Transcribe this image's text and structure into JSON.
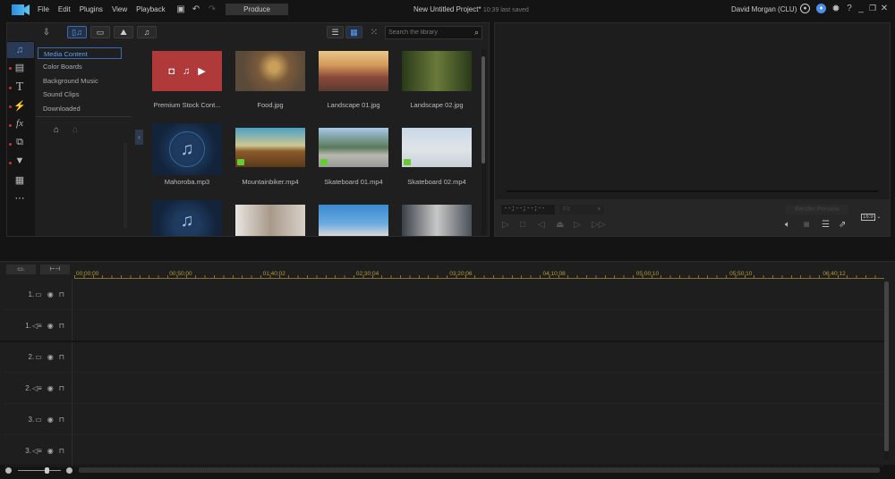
{
  "menu": [
    "File",
    "Edit",
    "Plugins",
    "View",
    "Playback"
  ],
  "produce_label": "Produce",
  "project_title": "New Untitled Project*",
  "save_status": "10:39 last saved",
  "user_name": "David Morgan (CLU)",
  "search_placeholder": "Search the library",
  "categories": [
    "Media Content",
    "Color Boards",
    "Background Music",
    "Sound Clips",
    "Downloaded"
  ],
  "media": [
    {
      "name": "Premium Stock Cont...",
      "type": "stock"
    },
    {
      "name": "Food.jpg",
      "type": "image"
    },
    {
      "name": "Landscape 01.jpg",
      "type": "image"
    },
    {
      "name": "Landscape 02.jpg",
      "type": "image"
    },
    {
      "name": "Mahoroba.mp3",
      "type": "audio"
    },
    {
      "name": "Mountainbiker.mp4",
      "type": "video"
    },
    {
      "name": "Skateboard 01.mp4",
      "type": "video"
    },
    {
      "name": "Skateboard 02.mp4",
      "type": "video"
    }
  ],
  "preview": {
    "timecode": "--;--;--;--",
    "fit": "Fit",
    "render_preview": "Render Preview",
    "aspect": "16:9"
  },
  "ruler": [
    "00;00;00",
    "00;50;00",
    "01;40;02",
    "02;30;04",
    "03;20;06",
    "04;10;08",
    "05;00;10",
    "05;50;10",
    "06;40;12"
  ],
  "tracks": [
    {
      "label": "1.",
      "kind": "video"
    },
    {
      "label": "1.",
      "kind": "audio"
    },
    {
      "label": "2.",
      "kind": "video"
    },
    {
      "label": "2.",
      "kind": "audio"
    },
    {
      "label": "3.",
      "kind": "video"
    },
    {
      "label": "3.",
      "kind": "audio"
    }
  ],
  "colors": {
    "accent": "#3a7bd5",
    "stock": "#b03a3a",
    "ruler": "#b59a3c"
  }
}
